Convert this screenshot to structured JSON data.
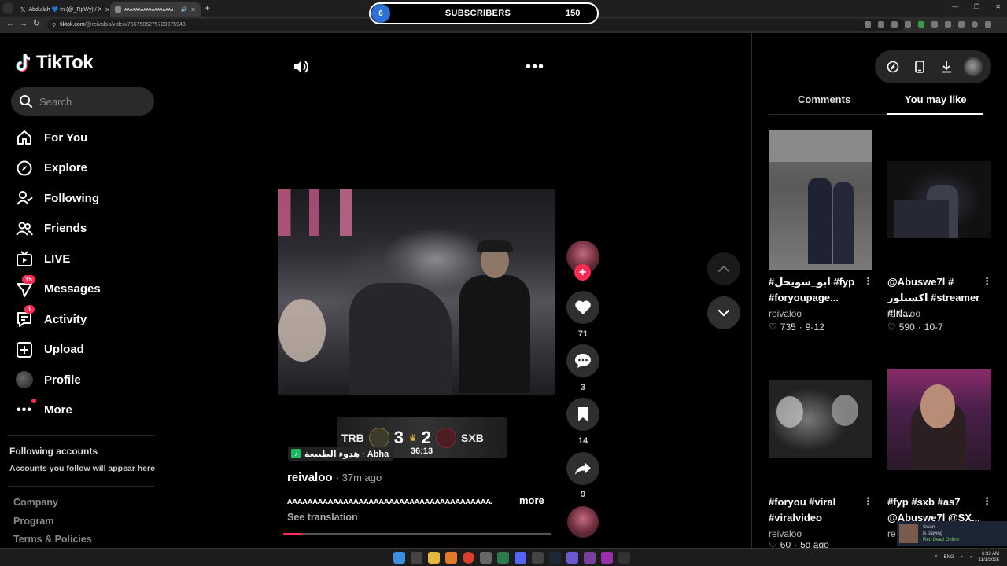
{
  "browser": {
    "tabs": [
      {
        "title": "Abdullah 💙 fn (@_RpWy) / X"
      },
      {
        "title": "ᴀᴀᴀᴀᴀᴀᴀᴀᴀᴀᴀᴀᴀᴀᴀᴀᴀᴀ"
      }
    ],
    "url_domain": "tiktok.com",
    "url_path": "/@reivaloo/video/7567585275723975943"
  },
  "overlay": {
    "sub_goal": "6",
    "label": "SUBSCRIBERS",
    "count": "150"
  },
  "sidebar": {
    "logo": "TikTok",
    "search_placeholder": "Search",
    "nav": [
      {
        "label": "For You",
        "icon": "home-icon"
      },
      {
        "label": "Explore",
        "icon": "compass-icon"
      },
      {
        "label": "Following",
        "icon": "user-follow-icon"
      },
      {
        "label": "Friends",
        "icon": "friends-icon"
      },
      {
        "label": "LIVE",
        "icon": "live-tv-icon"
      },
      {
        "label": "Messages",
        "icon": "paper-plane-icon",
        "badge": "15"
      },
      {
        "label": "Activity",
        "icon": "activity-icon",
        "badge": "1"
      },
      {
        "label": "Upload",
        "icon": "plus-square-icon"
      },
      {
        "label": "Profile",
        "icon": "avatar"
      },
      {
        "label": "More",
        "icon": "more-dots-icon"
      }
    ],
    "following_title": "Following accounts",
    "following_sub": "Accounts you follow will appear here",
    "footer_links": [
      "Company",
      "Program",
      "Terms & Policies"
    ]
  },
  "video": {
    "scoreboard": {
      "team_left": "TRB",
      "score_left": "3",
      "score_right": "2",
      "team_right": "SXB",
      "clock": "36:13"
    },
    "music": "هدوء الطبيعة · Abha",
    "author": "reivaloo",
    "time_ago": "· 37m ago",
    "caption": "ᴀᴀᴀᴀᴀᴀᴀᴀᴀᴀᴀᴀᴀᴀᴀᴀᴀᴀᴀᴀᴀᴀᴀᴀᴀᴀᴀᴀᴀᴀᴀᴀᴀᴀᴀᴀᴀᴀᴀᴀᴀᴀᴀᴀᴀᴀᴀᴀᴀᴀᴀᴀᴀᴀᴀᴀᴀᴀᴀᴀᴀᴀ",
    "more_label": "more",
    "see_translation": "See translation",
    "progress": 0.07
  },
  "actions": {
    "likes": "71",
    "comments": "3",
    "saves": "14",
    "shares": "9"
  },
  "right_panel": {
    "tabs": [
      "Comments",
      "You may like"
    ],
    "active_tab": "You may like",
    "cards": [
      {
        "title": "#ابو_سويحل #fyp #foryoupage...",
        "author": "reivaloo",
        "likes": "735",
        "date": "9-12"
      },
      {
        "title": "@Abuswe7l # اكسبلور #streamer #irl...",
        "author": "reivaloo",
        "likes": "590",
        "date": "10-7"
      },
      {
        "title": "#foryou #viral #viralvideo",
        "author": "reivaloo",
        "likes": "60",
        "date": "5d ago"
      },
      {
        "title": "#fyp #sxb #as7 @Abuswe7l @SX...",
        "author": "re",
        "likes": "",
        "date": ""
      }
    ]
  },
  "toast": {
    "name": "Swan",
    "status": "is playing",
    "game": "Red Dead Online"
  },
  "taskbar": {
    "lang": "ENG",
    "time": "6:33 AM",
    "date": "11/1/2025"
  }
}
